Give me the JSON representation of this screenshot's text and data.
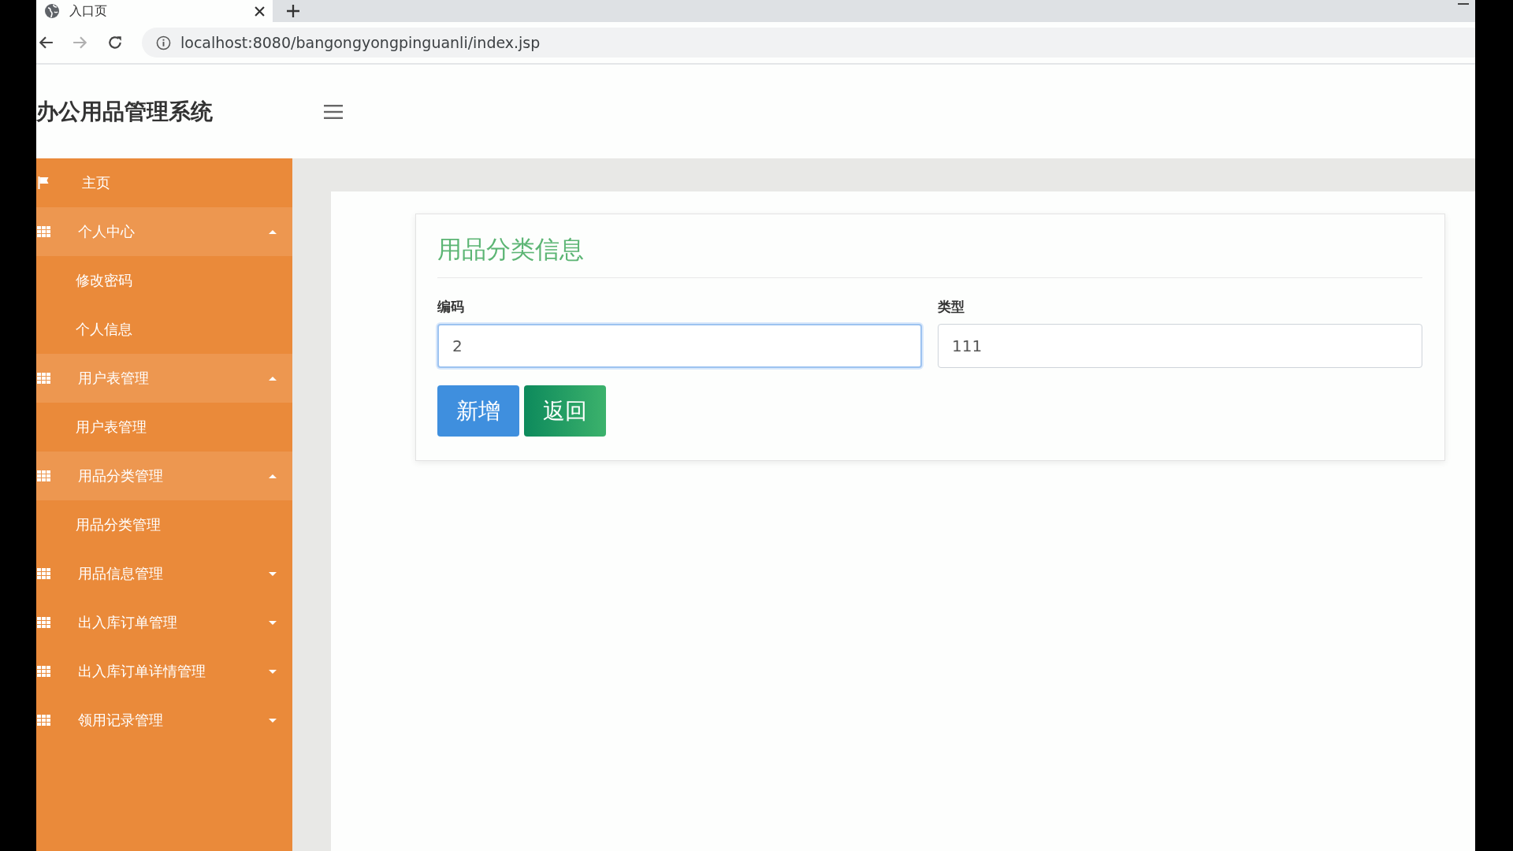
{
  "browser": {
    "tab": {
      "title": "入口页",
      "selected": true
    },
    "url": "localhost:8080/bangongyongpinguanli/index.jsp",
    "nav": [
      {
        "kind": "back",
        "disabled": false
      },
      {
        "kind": "forward",
        "disabled": true
      },
      {
        "kind": "reload",
        "disabled": false
      }
    ]
  },
  "app": {
    "title": "办公用品管理系统"
  },
  "sidebar": {
    "items": [
      {
        "kind": "home",
        "label": "主页",
        "expanded": false
      },
      {
        "kind": "group",
        "label": "个人中心",
        "expanded": true,
        "children": [
          {
            "label": "修改密码"
          },
          {
            "label": "个人信息"
          }
        ]
      },
      {
        "kind": "group",
        "label": "用户表管理",
        "expanded": true,
        "children": [
          {
            "label": "用户表管理"
          }
        ]
      },
      {
        "kind": "group",
        "label": "用品分类管理",
        "expanded": true,
        "children": [
          {
            "label": "用品分类管理"
          }
        ]
      },
      {
        "kind": "group",
        "label": "用品信息管理",
        "expanded": false
      },
      {
        "kind": "group",
        "label": "出入库订单管理",
        "expanded": false
      },
      {
        "kind": "group",
        "label": "出入库订单详情管理",
        "expanded": false
      },
      {
        "kind": "group",
        "label": "领用记录管理",
        "expanded": false
      }
    ]
  },
  "form": {
    "title": "用品分类信息",
    "fields": [
      {
        "label": "编码",
        "value": "2",
        "focused": true
      },
      {
        "label": "类型",
        "value": "111",
        "focused": false
      }
    ],
    "buttons": [
      {
        "kind": "primary",
        "label": "新增"
      },
      {
        "kind": "back",
        "label": "返回"
      }
    ]
  }
}
